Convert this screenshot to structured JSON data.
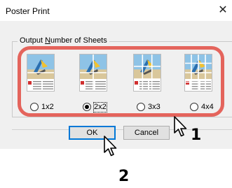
{
  "dialog": {
    "title": "Poster Print",
    "close_glyph": "✕",
    "group_label_prefix": "Output ",
    "group_label_mnemonic": "N",
    "group_label_suffix": "umber of Sheets",
    "options": [
      {
        "label": "1x2",
        "selected": false
      },
      {
        "label": "2x2",
        "selected": true
      },
      {
        "label": "3x3",
        "selected": false
      },
      {
        "label": "4x4",
        "selected": false
      }
    ],
    "ok_label": "OK",
    "cancel_label": "Cancel"
  },
  "annotations": {
    "step1": "1",
    "step2": "2",
    "highlight_color": "#e4645c"
  }
}
